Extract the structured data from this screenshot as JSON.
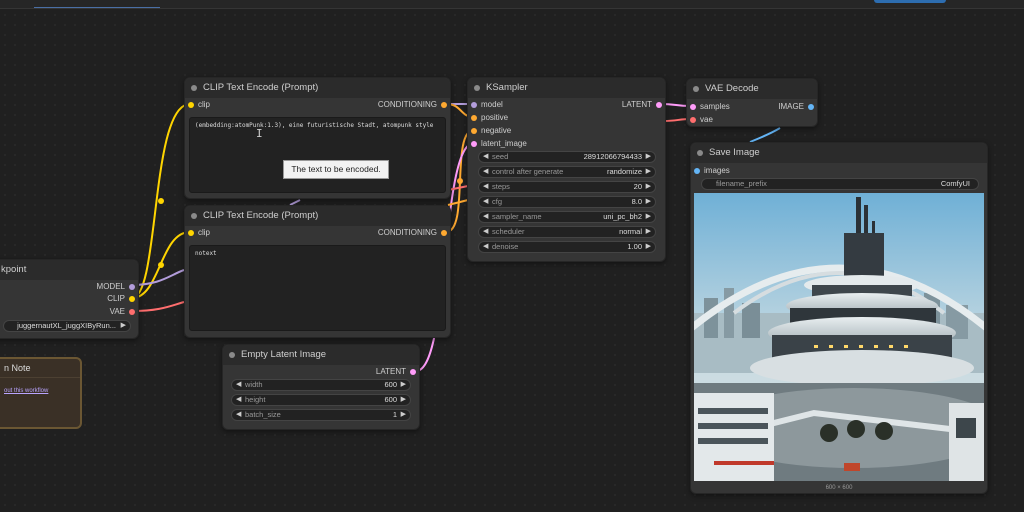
{
  "nodes": {
    "checkpoint": {
      "title": "kpoint",
      "outputs": {
        "model": "MODEL",
        "clip": "CLIP",
        "vae": "VAE"
      },
      "ckpt_name": "juggernautXL_juggXIByRun..."
    },
    "clip_pos": {
      "title": "CLIP Text Encode (Prompt)",
      "input_clip": "clip",
      "output_conditioning": "CONDITIONING",
      "text": "(embedding:atomPunk:1.3), eine futuristische Stadt, atompunk style"
    },
    "clip_neg": {
      "title": "CLIP Text Encode (Prompt)",
      "input_clip": "clip",
      "output_conditioning": "CONDITIONING",
      "text": "notext"
    },
    "ksampler": {
      "title": "KSampler",
      "inputs": {
        "model": "model",
        "positive": "positive",
        "negative": "negative",
        "latent_image": "latent_image"
      },
      "output_latent": "LATENT",
      "widgets": [
        {
          "label": "seed",
          "value": "28912066794433"
        },
        {
          "label": "control after generate",
          "value": "randomize"
        },
        {
          "label": "steps",
          "value": "20"
        },
        {
          "label": "cfg",
          "value": "8.0"
        },
        {
          "label": "sampler_name",
          "value": "uni_pc_bh2"
        },
        {
          "label": "scheduler",
          "value": "normal"
        },
        {
          "label": "denoise",
          "value": "1.00"
        }
      ]
    },
    "vae_decode": {
      "title": "VAE Decode",
      "inputs": {
        "samples": "samples",
        "vae": "vae"
      },
      "output_image": "IMAGE"
    },
    "save_image": {
      "title": "Save Image",
      "input_images": "images",
      "filename_prefix_label": "filename_prefix",
      "filename_prefix_value": "ComfyUI",
      "image_size": "600 × 600"
    },
    "empty_latent": {
      "title": "Empty Latent Image",
      "output_latent": "LATENT",
      "widgets": [
        {
          "label": "width",
          "value": "600"
        },
        {
          "label": "height",
          "value": "600"
        },
        {
          "label": "batch_size",
          "value": "1"
        }
      ]
    },
    "note": {
      "title": "n Note",
      "link": "out this workflow"
    }
  },
  "tooltip": "The text to be encoded.",
  "colors": {
    "clip": "#ffd500",
    "conditioning": "#ffa931",
    "model": "#b39ddb",
    "latent": "#ff9cf9",
    "vae": "#ff6e6e",
    "image": "#64b5f6"
  },
  "icons": {
    "decrement": "arrow-left-icon",
    "increment": "arrow-right-icon",
    "text_cursor": "i-beam-cursor-icon"
  }
}
